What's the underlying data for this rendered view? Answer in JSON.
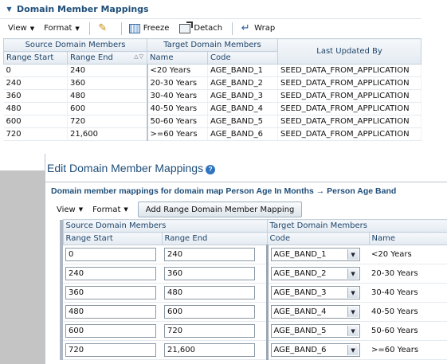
{
  "top": {
    "title": "Domain Member Mappings",
    "toolbar": {
      "view": "View",
      "format": "Format",
      "freeze": "Freeze",
      "detach": "Detach",
      "wrap": "Wrap"
    },
    "group_headers": {
      "source": "Source Domain Members",
      "target": "Target Domain Members",
      "last_updated": "Last Updated By"
    },
    "columns": {
      "range_start": "Range Start",
      "range_end": "Range End",
      "name": "Name",
      "code": "Code"
    },
    "rows": [
      {
        "range_start": "0",
        "range_end": "240",
        "name": "<20 Years",
        "code": "AGE_BAND_1",
        "updated_by": "SEED_DATA_FROM_APPLICATION"
      },
      {
        "range_start": "240",
        "range_end": "360",
        "name": "20-30 Years",
        "code": "AGE_BAND_2",
        "updated_by": "SEED_DATA_FROM_APPLICATION"
      },
      {
        "range_start": "360",
        "range_end": "480",
        "name": "30-40 Years",
        "code": "AGE_BAND_3",
        "updated_by": "SEED_DATA_FROM_APPLICATION"
      },
      {
        "range_start": "480",
        "range_end": "600",
        "name": "40-50 Years",
        "code": "AGE_BAND_4",
        "updated_by": "SEED_DATA_FROM_APPLICATION"
      },
      {
        "range_start": "600",
        "range_end": "720",
        "name": "50-60 Years",
        "code": "AGE_BAND_5",
        "updated_by": "SEED_DATA_FROM_APPLICATION"
      },
      {
        "range_start": "720",
        "range_end": "21,600",
        "name": ">=60 Years",
        "code": "AGE_BAND_6",
        "updated_by": "SEED_DATA_FROM_APPLICATION"
      }
    ]
  },
  "dialog": {
    "title": "Edit Domain Member Mappings",
    "subtitle": "Domain member mappings for domain map Person Age In Months → Person Age Band",
    "toolbar": {
      "view": "View",
      "format": "Format",
      "add_button": "Add Range Domain Member Mapping"
    },
    "group_headers": {
      "source": "Source Domain Members",
      "target": "Target Domain Members"
    },
    "columns": {
      "range_start": "Range Start",
      "range_end": "Range End",
      "code": "Code",
      "name": "Name"
    },
    "rows": [
      {
        "range_start": "0",
        "range_end": "240",
        "code": "AGE_BAND_1",
        "name": "<20 Years"
      },
      {
        "range_start": "240",
        "range_end": "360",
        "code": "AGE_BAND_2",
        "name": "20-30 Years"
      },
      {
        "range_start": "360",
        "range_end": "480",
        "code": "AGE_BAND_3",
        "name": "30-40 Years"
      },
      {
        "range_start": "480",
        "range_end": "600",
        "code": "AGE_BAND_4",
        "name": "40-50 Years"
      },
      {
        "range_start": "600",
        "range_end": "720",
        "code": "AGE_BAND_5",
        "name": "50-60 Years"
      },
      {
        "range_start": "720",
        "range_end": "21,600",
        "code": "AGE_BAND_6",
        "name": ">=60 Years"
      }
    ]
  },
  "icons": [
    "collapse-icon",
    "pencil-icon",
    "freeze-icon",
    "detach-icon",
    "wrap-icon",
    "help-icon",
    "sort-icon",
    "chevron-down-icon"
  ]
}
